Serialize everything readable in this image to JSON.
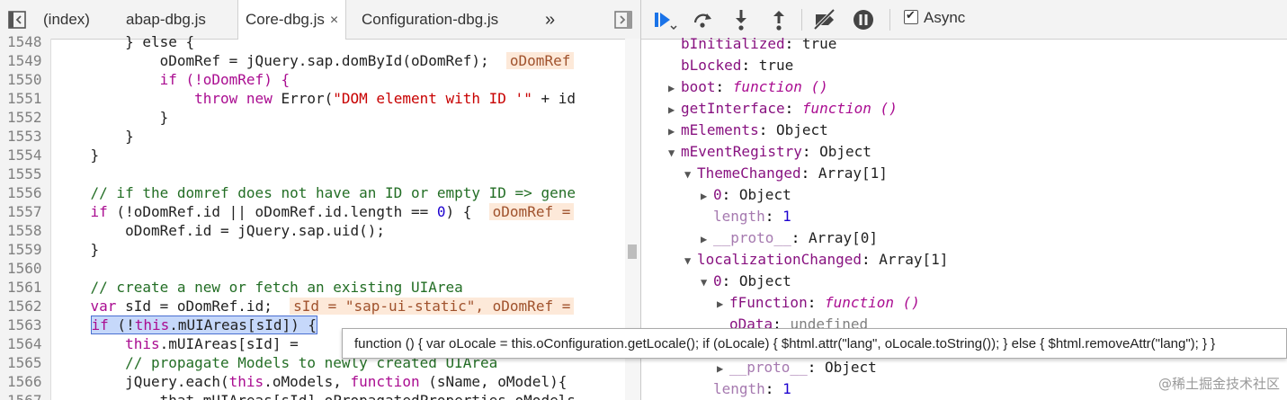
{
  "tabs": {
    "items": [
      {
        "label": "(index)"
      },
      {
        "label": "abap-dbg.js"
      },
      {
        "label": "Core-dbg.js",
        "close": "×"
      },
      {
        "label": "Configuration-dbg.js"
      }
    ],
    "more": "»"
  },
  "code_lines": [
    {
      "n": "1548"
    },
    {
      "n": "1549"
    },
    {
      "n": "1550"
    },
    {
      "n": "1551"
    },
    {
      "n": "1552"
    },
    {
      "n": "1553"
    },
    {
      "n": "1554"
    },
    {
      "n": "1555"
    },
    {
      "n": "1556"
    },
    {
      "n": "1557"
    },
    {
      "n": "1558"
    },
    {
      "n": "1559"
    },
    {
      "n": "1560"
    },
    {
      "n": "1561"
    },
    {
      "n": "1562"
    },
    {
      "n": "1563"
    },
    {
      "n": "1564"
    },
    {
      "n": "1565"
    },
    {
      "n": "1566"
    },
    {
      "n": "1567"
    }
  ],
  "code_text": {
    "l1548": "        } else {",
    "l1549a": "            oDomRef = jQuery.sap.domById(oDomRef);",
    "l1549b": "oDomRef",
    "l1550": "            if (!oDomRef) {",
    "l1551a": "throw new",
    "l1551b": " Error(",
    "l1551c": "\"DOM element with ID '\"",
    "l1551d": " + id",
    "l1552": "            }",
    "l1553": "        }",
    "l1554": "    }",
    "l1556": "    // if the domref does not have an ID or empty ID => gene",
    "l1557a": "if",
    "l1557b": " (!oDomRef.id || oDomRef.id.length == ",
    "l1557c": "0",
    "l1557d": ") {",
    "l1557e": "oDomRef =",
    "l1558": "        oDomRef.id = jQuery.sap.uid();",
    "l1559": "    }",
    "l1561": "    // create a new or fetch an existing UIArea",
    "l1562a": "var",
    "l1562b": " sId = oDomRef.id;",
    "l1562c": "sId = \"sap-ui-static\", oDomRef =",
    "l1563a": "if",
    "l1563b": " (!",
    "l1563c": "this",
    "l1563d": ".mUIAreas[sId]) {",
    "l1564a": "this",
    "l1564b": ".mUIAreas[sId] =",
    "l1565": "        // propagate Models to newly created UIArea",
    "l1566a": "        jQuery.each(",
    "l1566b": "this",
    "l1566c": ".oModels, ",
    "l1566d": "function",
    "l1566e": " (sName, oModel){",
    "l1567": "            that.mUIAreas[sId].oPropagatedProperties.oModels"
  },
  "tooltip": "function () { var oLocale = this.oConfiguration.getLocale(); if (oLocale) { $html.attr(\"lang\", oLocale.toString()); } else { $html.removeAttr(\"lang\"); } }",
  "toolbar": {
    "async_label": "Async",
    "async_checked": true
  },
  "scope": [
    {
      "key": "bInitialized",
      "value": "true"
    },
    {
      "key": "bLocked",
      "value": "true"
    },
    {
      "key": "boot",
      "value": "function ()"
    },
    {
      "key": "getInterface",
      "value": "function ()"
    },
    {
      "key": "mElements",
      "value": "Object"
    },
    {
      "key": "mEventRegistry",
      "value": "Object"
    },
    {
      "key": "ThemeChanged",
      "value": "Array[1]"
    },
    {
      "key": "0",
      "value": "Object"
    },
    {
      "key": "length",
      "value": "1"
    },
    {
      "key": "__proto__",
      "value": "Array[0]"
    },
    {
      "key": "localizationChanged",
      "value": "Array[1]"
    },
    {
      "key": "0",
      "value": "Object"
    },
    {
      "key": "fFunction",
      "value": "function ()"
    },
    {
      "key": "oData",
      "value": "undefined"
    },
    {
      "key": "__proto__",
      "value": "Object"
    },
    {
      "key": "length",
      "value": "1"
    }
  ],
  "watermark": "@稀土掘金技术社区"
}
